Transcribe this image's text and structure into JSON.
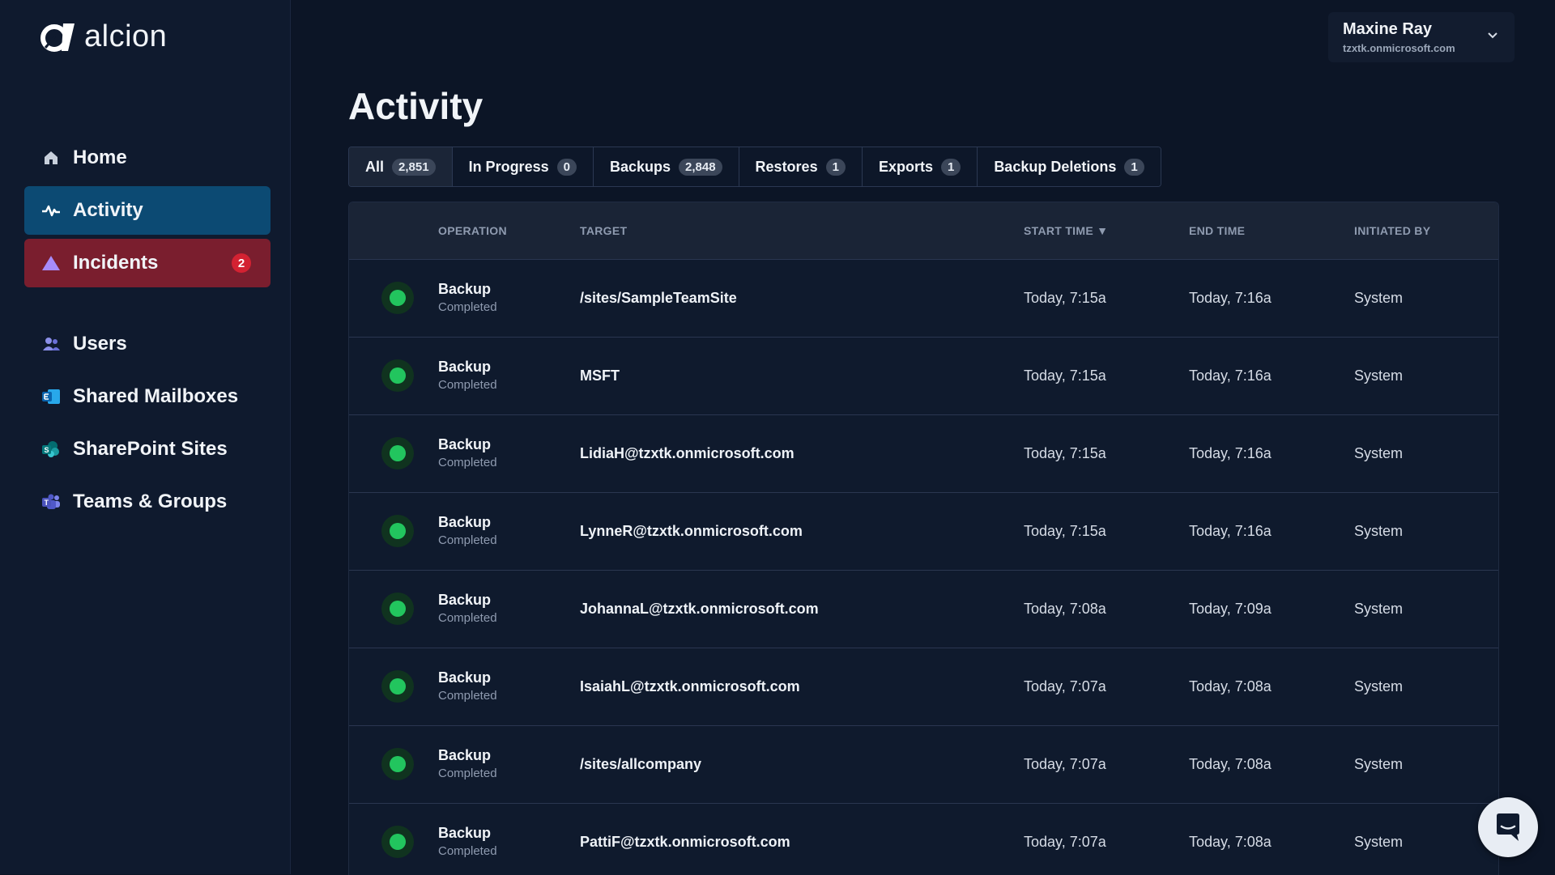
{
  "app": {
    "logo_text": "alcion"
  },
  "sidebar": {
    "items": [
      {
        "label": "Home"
      },
      {
        "label": "Activity"
      },
      {
        "label": "Incidents",
        "badge": "2"
      },
      {
        "label": "Users"
      },
      {
        "label": "Shared Mailboxes"
      },
      {
        "label": "SharePoint Sites"
      },
      {
        "label": "Teams & Groups"
      }
    ]
  },
  "user": {
    "name": "Maxine Ray",
    "email": "tzxtk.onmicrosoft.com"
  },
  "page": {
    "title": "Activity"
  },
  "tabs": [
    {
      "label": "All",
      "count": "2,851",
      "active": true
    },
    {
      "label": "In Progress",
      "count": "0"
    },
    {
      "label": "Backups",
      "count": "2,848"
    },
    {
      "label": "Restores",
      "count": "1"
    },
    {
      "label": "Exports",
      "count": "1"
    },
    {
      "label": "Backup Deletions",
      "count": "1"
    }
  ],
  "table": {
    "headers": {
      "operation": "OPERATION",
      "target": "TARGET",
      "start_time": "START TIME ▼",
      "end_time": "END TIME",
      "initiated_by": "INITIATED BY"
    },
    "rows": [
      {
        "operation": "Backup",
        "status": "Completed",
        "target": "/sites/SampleTeamSite",
        "start": "Today, 7:15a",
        "end": "Today, 7:16a",
        "initiated_by": "System"
      },
      {
        "operation": "Backup",
        "status": "Completed",
        "target": "MSFT",
        "start": "Today, 7:15a",
        "end": "Today, 7:16a",
        "initiated_by": "System"
      },
      {
        "operation": "Backup",
        "status": "Completed",
        "target": "LidiaH@tzxtk.onmicrosoft.com",
        "start": "Today, 7:15a",
        "end": "Today, 7:16a",
        "initiated_by": "System"
      },
      {
        "operation": "Backup",
        "status": "Completed",
        "target": "LynneR@tzxtk.onmicrosoft.com",
        "start": "Today, 7:15a",
        "end": "Today, 7:16a",
        "initiated_by": "System"
      },
      {
        "operation": "Backup",
        "status": "Completed",
        "target": "JohannaL@tzxtk.onmicrosoft.com",
        "start": "Today, 7:08a",
        "end": "Today, 7:09a",
        "initiated_by": "System"
      },
      {
        "operation": "Backup",
        "status": "Completed",
        "target": "IsaiahL@tzxtk.onmicrosoft.com",
        "start": "Today, 7:07a",
        "end": "Today, 7:08a",
        "initiated_by": "System"
      },
      {
        "operation": "Backup",
        "status": "Completed",
        "target": "/sites/allcompany",
        "start": "Today, 7:07a",
        "end": "Today, 7:08a",
        "initiated_by": "System"
      },
      {
        "operation": "Backup",
        "status": "Completed",
        "target": "PattiF@tzxtk.onmicrosoft.com",
        "start": "Today, 7:07a",
        "end": "Today, 7:08a",
        "initiated_by": "System"
      }
    ]
  },
  "colors": {
    "background": "#0c1526",
    "sidebar": "#0f1a2e",
    "active_nav": "#0c4a73",
    "incident_nav": "#7a1e2e",
    "status_completed": "#22c55e",
    "badge_red": "#d32232"
  }
}
